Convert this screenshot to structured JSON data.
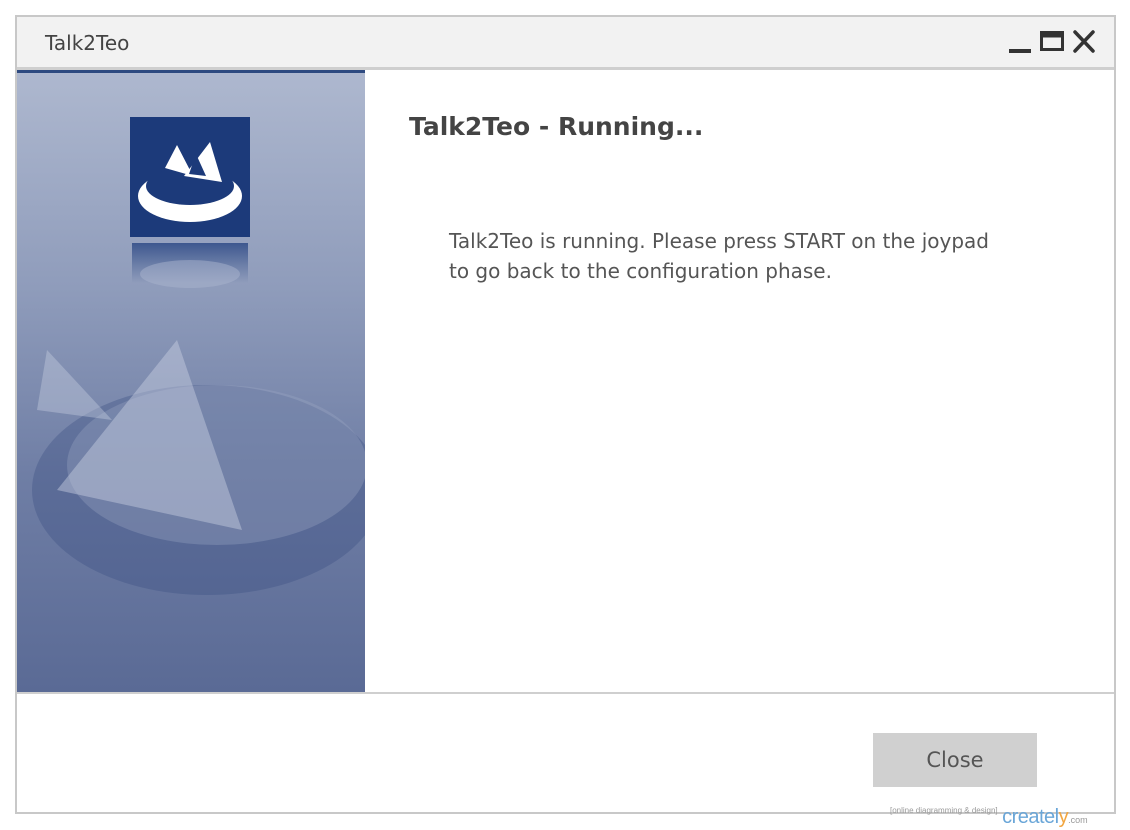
{
  "window": {
    "title": "Talk2Teo",
    "controls": [
      "minimize-icon",
      "maximize-icon",
      "close-icon"
    ]
  },
  "main": {
    "heading": "Talk2Teo - Running...",
    "message": "Talk2Teo is running. Please press START on the joypad to go back to the configuration phase."
  },
  "footer": {
    "close_label": "Close"
  },
  "watermark": {
    "tagline": "[online diagramming & design]",
    "brand_prefix": "createl",
    "brand_y": "y",
    "domain": ".com"
  },
  "colors": {
    "logo_blue": "#1c3a7a",
    "sidebar_blue": "#6f7ea5",
    "button_gray": "#d0d0d0"
  }
}
